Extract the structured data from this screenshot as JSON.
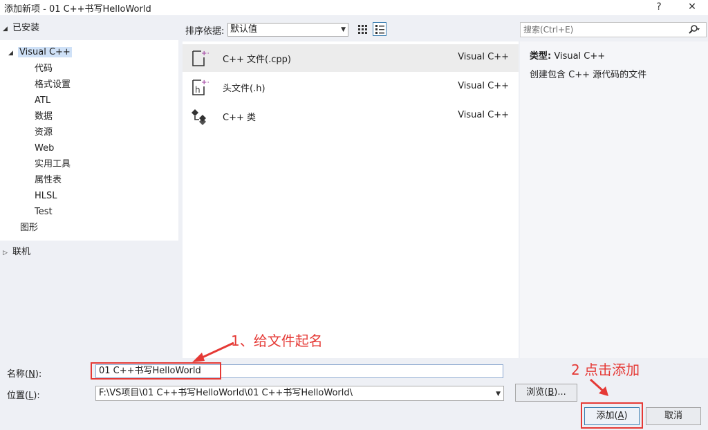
{
  "window": {
    "title": "添加新项 - 01 C++书写HelloWorld",
    "help_label": "?",
    "close_label": "✕"
  },
  "left_pane": {
    "installed": "已安装",
    "root": "Visual C++",
    "children": [
      "代码",
      "格式设置",
      "ATL",
      "数据",
      "资源",
      "Web",
      "实用工具",
      "属性表",
      "HLSL",
      "Test"
    ],
    "graphics": "图形",
    "online": "联机"
  },
  "toolbar": {
    "sort_label": "排序依据:",
    "sort_value": "默认值"
  },
  "search": {
    "placeholder": "搜索(Ctrl+E)"
  },
  "templates": [
    {
      "name": "C++ 文件(.cpp)",
      "lang": "Visual C++",
      "icon": "cpp-file-icon"
    },
    {
      "name": "头文件(.h)",
      "lang": "Visual C++",
      "icon": "header-file-icon"
    },
    {
      "name": "C++ 类",
      "lang": "Visual C++",
      "icon": "cpp-class-icon"
    }
  ],
  "details": {
    "type_label": "类型:",
    "type_value": "Visual C++",
    "description": "创建包含 C++ 源代码的文件"
  },
  "form": {
    "name_label": "名称",
    "name_key": "N",
    "name_value": "01 C++书写HelloWorld",
    "location_label": "位置",
    "location_key": "L",
    "location_value": "F:\\VS项目\\01 C++书写HelloWorld\\01 C++书写HelloWorld\\"
  },
  "buttons": {
    "browse_label": "浏览",
    "browse_key": "B",
    "browse_suffix": "...",
    "add_label": "添加",
    "add_key": "A",
    "cancel_label": "取消"
  },
  "annotations": {
    "step1": "1、给文件起名",
    "step2": "2 点击添加"
  },
  "colors": {
    "annotation": "#e53935",
    "selection": "#cfe1f7",
    "accent": "#3c7fb1",
    "icon_purple": "#a64ca6"
  }
}
